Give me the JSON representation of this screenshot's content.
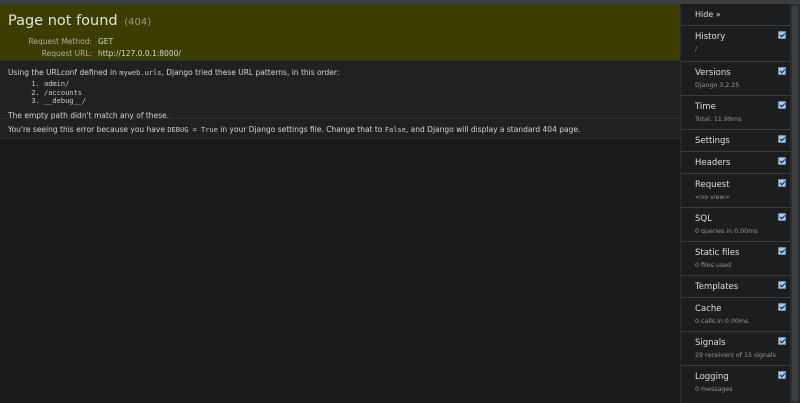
{
  "summary": {
    "title": "Page not found",
    "code": "(404)",
    "request_method_label": "Request Method:",
    "request_method": "GET",
    "request_url_label": "Request URL:",
    "request_url": "http://127.0.0.1:8000/"
  },
  "info": {
    "intro_pre": "Using the URLconf defined in ",
    "urlconf": "myweb.urls",
    "intro_post": ", Django tried these URL patterns, in this order:",
    "patterns": [
      "admin/",
      "/accounts",
      "__debug__/"
    ],
    "empty_path": "The empty path didn't match any of these."
  },
  "explanation": {
    "pre": "You're seeing this error because you have ",
    "debug_setting": "DEBUG = True",
    "mid": " in your Django settings file. Change that to ",
    "false_value": "False",
    "post": ", and Django will display a standard 404 page."
  },
  "toolbar": {
    "hide_label": "Hide »",
    "panels": [
      {
        "label": "History",
        "sub": "/"
      },
      {
        "label": "Versions",
        "sub": "Django 3.2.25"
      },
      {
        "label": "Time",
        "sub": "Total: 11.99ms"
      },
      {
        "label": "Settings",
        "sub": ""
      },
      {
        "label": "Headers",
        "sub": ""
      },
      {
        "label": "Request",
        "sub": "<no view>"
      },
      {
        "label": "SQL",
        "sub": "0 queries in 0.00ms"
      },
      {
        "label": "Static files",
        "sub": "0 files used"
      },
      {
        "label": "Templates",
        "sub": ""
      },
      {
        "label": "Cache",
        "sub": "0 calls in 0.00ms"
      },
      {
        "label": "Signals",
        "sub": "29 receivers of 15 signals"
      },
      {
        "label": "Logging",
        "sub": "0 messages"
      }
    ]
  }
}
